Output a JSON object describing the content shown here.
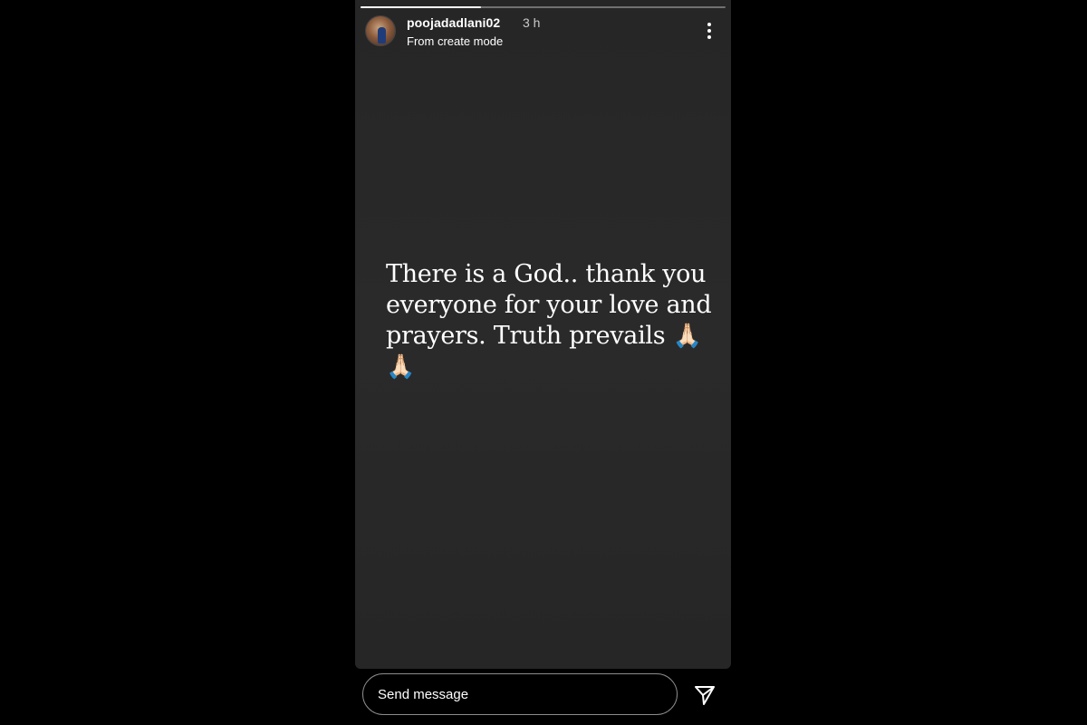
{
  "story": {
    "progress": 0.33,
    "username": "poojadadlani02",
    "time_ago": "3 h",
    "subtitle": "From create mode",
    "text_lines": [
      "There is a God.. thank you",
      "everyone for your love and",
      "prayers. Truth prevails"
    ],
    "emoji": "🙏🏻🙏🏻",
    "icons": {
      "more": "more-vertical-icon",
      "send": "send-icon"
    }
  },
  "reply": {
    "placeholder": "Send message"
  },
  "colors": {
    "background": "#000000",
    "story_background": "#262626",
    "text": "#ffffff",
    "avatar_accent": "#1e3c7a"
  }
}
